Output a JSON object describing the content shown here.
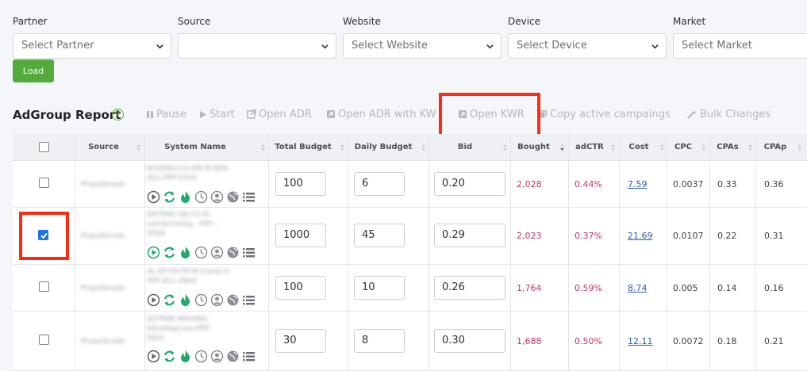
{
  "filters": [
    {
      "label": "Partner",
      "placeholder": "Select Partner"
    },
    {
      "label": "Source",
      "placeholder": ""
    },
    {
      "label": "Website",
      "placeholder": "Select Website"
    },
    {
      "label": "Device",
      "placeholder": "Select Device"
    },
    {
      "label": "Market",
      "placeholder": "Select Market"
    }
  ],
  "load_label": "Load",
  "report": {
    "title": "AdGroup Report",
    "help": "?",
    "toolbar": {
      "pause": "Pause",
      "start": "Start",
      "open_adr": "Open ADR",
      "open_adr_kw": "Open ADR with KW",
      "open_kwr": "Open KWR",
      "copy_active": "Copy active campaings",
      "bulk_changes": "Bulk Changes"
    }
  },
  "colors": {
    "accent_green": "#53ab3b",
    "highlight_red": "#ff2a12",
    "metric_pink": "#c43566",
    "link_blue": "#2b5fb4",
    "checkbox_blue": "#1a73e8"
  },
  "table": {
    "headers": {
      "source": "Source",
      "system_name": "System Name",
      "total_budget": "Total Budget",
      "daily_budget": "Daily Budget",
      "bid": "Bid",
      "bought": "Bought",
      "adctr": "adCTR",
      "cost": "Cost",
      "cpc": "CPC",
      "cpas": "CPAs",
      "cpap": "CPAp"
    },
    "rows": [
      {
        "checked": false,
        "source": "Propellerads",
        "name1": "KCWSKU-CA-EN-M-KEN",
        "name2": "ZCL-PPP-0304",
        "name3": "",
        "total_budget": "100",
        "daily_budget": "6",
        "bid": "0.20",
        "bought": "2,028",
        "adctr": "0.44%",
        "cost": "7.59",
        "cpc": "0.0037",
        "cpas": "0.33",
        "cpap": "0.36"
      },
      {
        "checked": true,
        "source": "Propellerads",
        "name1": "DSTRKE-GE-CS-KI",
        "name2": "LanderGoing - PRF -",
        "name3": "0304",
        "total_budget": "1000",
        "daily_budget": "45",
        "bid": "0.29",
        "bought": "2,023",
        "adctr": "0.37%",
        "cost": "21.69",
        "cpc": "0.0107",
        "cpas": "0.22",
        "cpap": "0.31"
      },
      {
        "checked": false,
        "source": "Propellerads",
        "name1": "AL-EP-FR-FR-M-Camp-S-",
        "name2": "PPP-ZCL-0904",
        "name3": "",
        "total_budget": "100",
        "daily_budget": "10",
        "bid": "0.26",
        "bought": "1,764",
        "adctr": "0.59%",
        "cost": "8.74",
        "cpc": "0.005",
        "cpas": "0.14",
        "cpap": "0.16"
      },
      {
        "checked": false,
        "source": "Propellerads",
        "name1": "DSTRKE-MAXIMA-",
        "name2": "DSrategicoss-PRF-",
        "name3": "0401",
        "total_budget": "30",
        "daily_budget": "8",
        "bid": "0.30",
        "bought": "1,688",
        "adctr": "0.50%",
        "cost": "12.11",
        "cpc": "0.0072",
        "cpas": "0.18",
        "cpap": "0.21"
      }
    ]
  }
}
